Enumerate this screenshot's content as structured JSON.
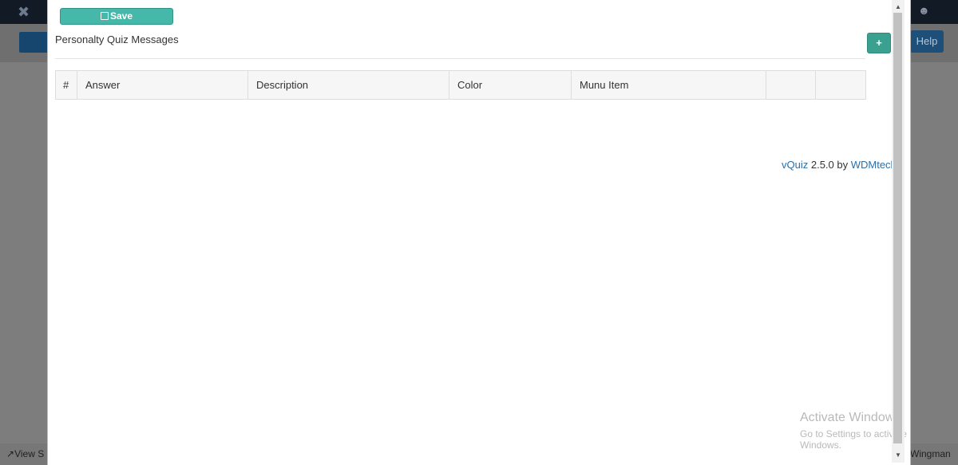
{
  "background": {
    "help_label": "Help",
    "view_site_label": "View S",
    "wingman_label": "Wingman"
  },
  "toolbar": {
    "save_label": "Save",
    "add_label": "+"
  },
  "page": {
    "title": "Personalty Quiz Messages"
  },
  "table": {
    "headers": [
      "#",
      "Answer",
      "Description",
      "Color",
      "Munu Item",
      "",
      ""
    ]
  },
  "footer": {
    "product_link": "vQuiz",
    "version_text": " 2.5.0 by ",
    "vendor_link": "WDMtech"
  },
  "watermark": {
    "title": "Activate Windows",
    "subtitle": "Go to Settings to activate Windows."
  },
  "colors": {
    "save_button": "#46b8a9",
    "add_button": "#3aa08f",
    "link": "#2a6fa8",
    "topbar": "#121a26"
  }
}
